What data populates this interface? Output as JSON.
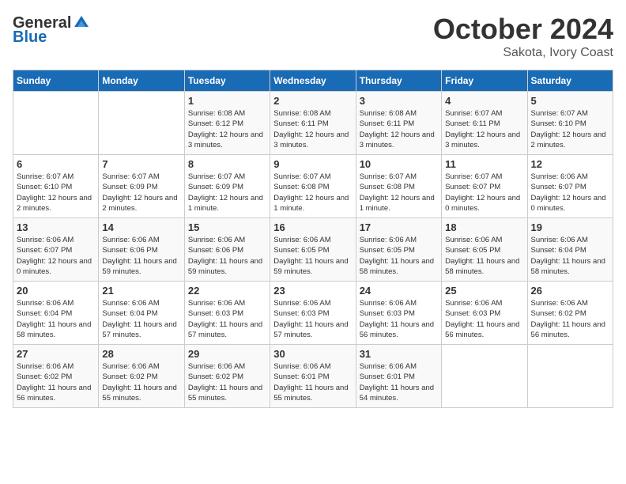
{
  "header": {
    "logo_general": "General",
    "logo_blue": "Blue",
    "month": "October 2024",
    "location": "Sakota, Ivory Coast"
  },
  "weekdays": [
    "Sunday",
    "Monday",
    "Tuesday",
    "Wednesday",
    "Thursday",
    "Friday",
    "Saturday"
  ],
  "weeks": [
    [
      {
        "day": "",
        "text": ""
      },
      {
        "day": "",
        "text": ""
      },
      {
        "day": "1",
        "text": "Sunrise: 6:08 AM\nSunset: 6:12 PM\nDaylight: 12 hours and 3 minutes."
      },
      {
        "day": "2",
        "text": "Sunrise: 6:08 AM\nSunset: 6:11 PM\nDaylight: 12 hours and 3 minutes."
      },
      {
        "day": "3",
        "text": "Sunrise: 6:08 AM\nSunset: 6:11 PM\nDaylight: 12 hours and 3 minutes."
      },
      {
        "day": "4",
        "text": "Sunrise: 6:07 AM\nSunset: 6:11 PM\nDaylight: 12 hours and 3 minutes."
      },
      {
        "day": "5",
        "text": "Sunrise: 6:07 AM\nSunset: 6:10 PM\nDaylight: 12 hours and 2 minutes."
      }
    ],
    [
      {
        "day": "6",
        "text": "Sunrise: 6:07 AM\nSunset: 6:10 PM\nDaylight: 12 hours and 2 minutes."
      },
      {
        "day": "7",
        "text": "Sunrise: 6:07 AM\nSunset: 6:09 PM\nDaylight: 12 hours and 2 minutes."
      },
      {
        "day": "8",
        "text": "Sunrise: 6:07 AM\nSunset: 6:09 PM\nDaylight: 12 hours and 1 minute."
      },
      {
        "day": "9",
        "text": "Sunrise: 6:07 AM\nSunset: 6:08 PM\nDaylight: 12 hours and 1 minute."
      },
      {
        "day": "10",
        "text": "Sunrise: 6:07 AM\nSunset: 6:08 PM\nDaylight: 12 hours and 1 minute."
      },
      {
        "day": "11",
        "text": "Sunrise: 6:07 AM\nSunset: 6:07 PM\nDaylight: 12 hours and 0 minutes."
      },
      {
        "day": "12",
        "text": "Sunrise: 6:06 AM\nSunset: 6:07 PM\nDaylight: 12 hours and 0 minutes."
      }
    ],
    [
      {
        "day": "13",
        "text": "Sunrise: 6:06 AM\nSunset: 6:07 PM\nDaylight: 12 hours and 0 minutes."
      },
      {
        "day": "14",
        "text": "Sunrise: 6:06 AM\nSunset: 6:06 PM\nDaylight: 11 hours and 59 minutes."
      },
      {
        "day": "15",
        "text": "Sunrise: 6:06 AM\nSunset: 6:06 PM\nDaylight: 11 hours and 59 minutes."
      },
      {
        "day": "16",
        "text": "Sunrise: 6:06 AM\nSunset: 6:05 PM\nDaylight: 11 hours and 59 minutes."
      },
      {
        "day": "17",
        "text": "Sunrise: 6:06 AM\nSunset: 6:05 PM\nDaylight: 11 hours and 58 minutes."
      },
      {
        "day": "18",
        "text": "Sunrise: 6:06 AM\nSunset: 6:05 PM\nDaylight: 11 hours and 58 minutes."
      },
      {
        "day": "19",
        "text": "Sunrise: 6:06 AM\nSunset: 6:04 PM\nDaylight: 11 hours and 58 minutes."
      }
    ],
    [
      {
        "day": "20",
        "text": "Sunrise: 6:06 AM\nSunset: 6:04 PM\nDaylight: 11 hours and 58 minutes."
      },
      {
        "day": "21",
        "text": "Sunrise: 6:06 AM\nSunset: 6:04 PM\nDaylight: 11 hours and 57 minutes."
      },
      {
        "day": "22",
        "text": "Sunrise: 6:06 AM\nSunset: 6:03 PM\nDaylight: 11 hours and 57 minutes."
      },
      {
        "day": "23",
        "text": "Sunrise: 6:06 AM\nSunset: 6:03 PM\nDaylight: 11 hours and 57 minutes."
      },
      {
        "day": "24",
        "text": "Sunrise: 6:06 AM\nSunset: 6:03 PM\nDaylight: 11 hours and 56 minutes."
      },
      {
        "day": "25",
        "text": "Sunrise: 6:06 AM\nSunset: 6:03 PM\nDaylight: 11 hours and 56 minutes."
      },
      {
        "day": "26",
        "text": "Sunrise: 6:06 AM\nSunset: 6:02 PM\nDaylight: 11 hours and 56 minutes."
      }
    ],
    [
      {
        "day": "27",
        "text": "Sunrise: 6:06 AM\nSunset: 6:02 PM\nDaylight: 11 hours and 56 minutes."
      },
      {
        "day": "28",
        "text": "Sunrise: 6:06 AM\nSunset: 6:02 PM\nDaylight: 11 hours and 55 minutes."
      },
      {
        "day": "29",
        "text": "Sunrise: 6:06 AM\nSunset: 6:02 PM\nDaylight: 11 hours and 55 minutes."
      },
      {
        "day": "30",
        "text": "Sunrise: 6:06 AM\nSunset: 6:01 PM\nDaylight: 11 hours and 55 minutes."
      },
      {
        "day": "31",
        "text": "Sunrise: 6:06 AM\nSunset: 6:01 PM\nDaylight: 11 hours and 54 minutes."
      },
      {
        "day": "",
        "text": ""
      },
      {
        "day": "",
        "text": ""
      }
    ]
  ]
}
